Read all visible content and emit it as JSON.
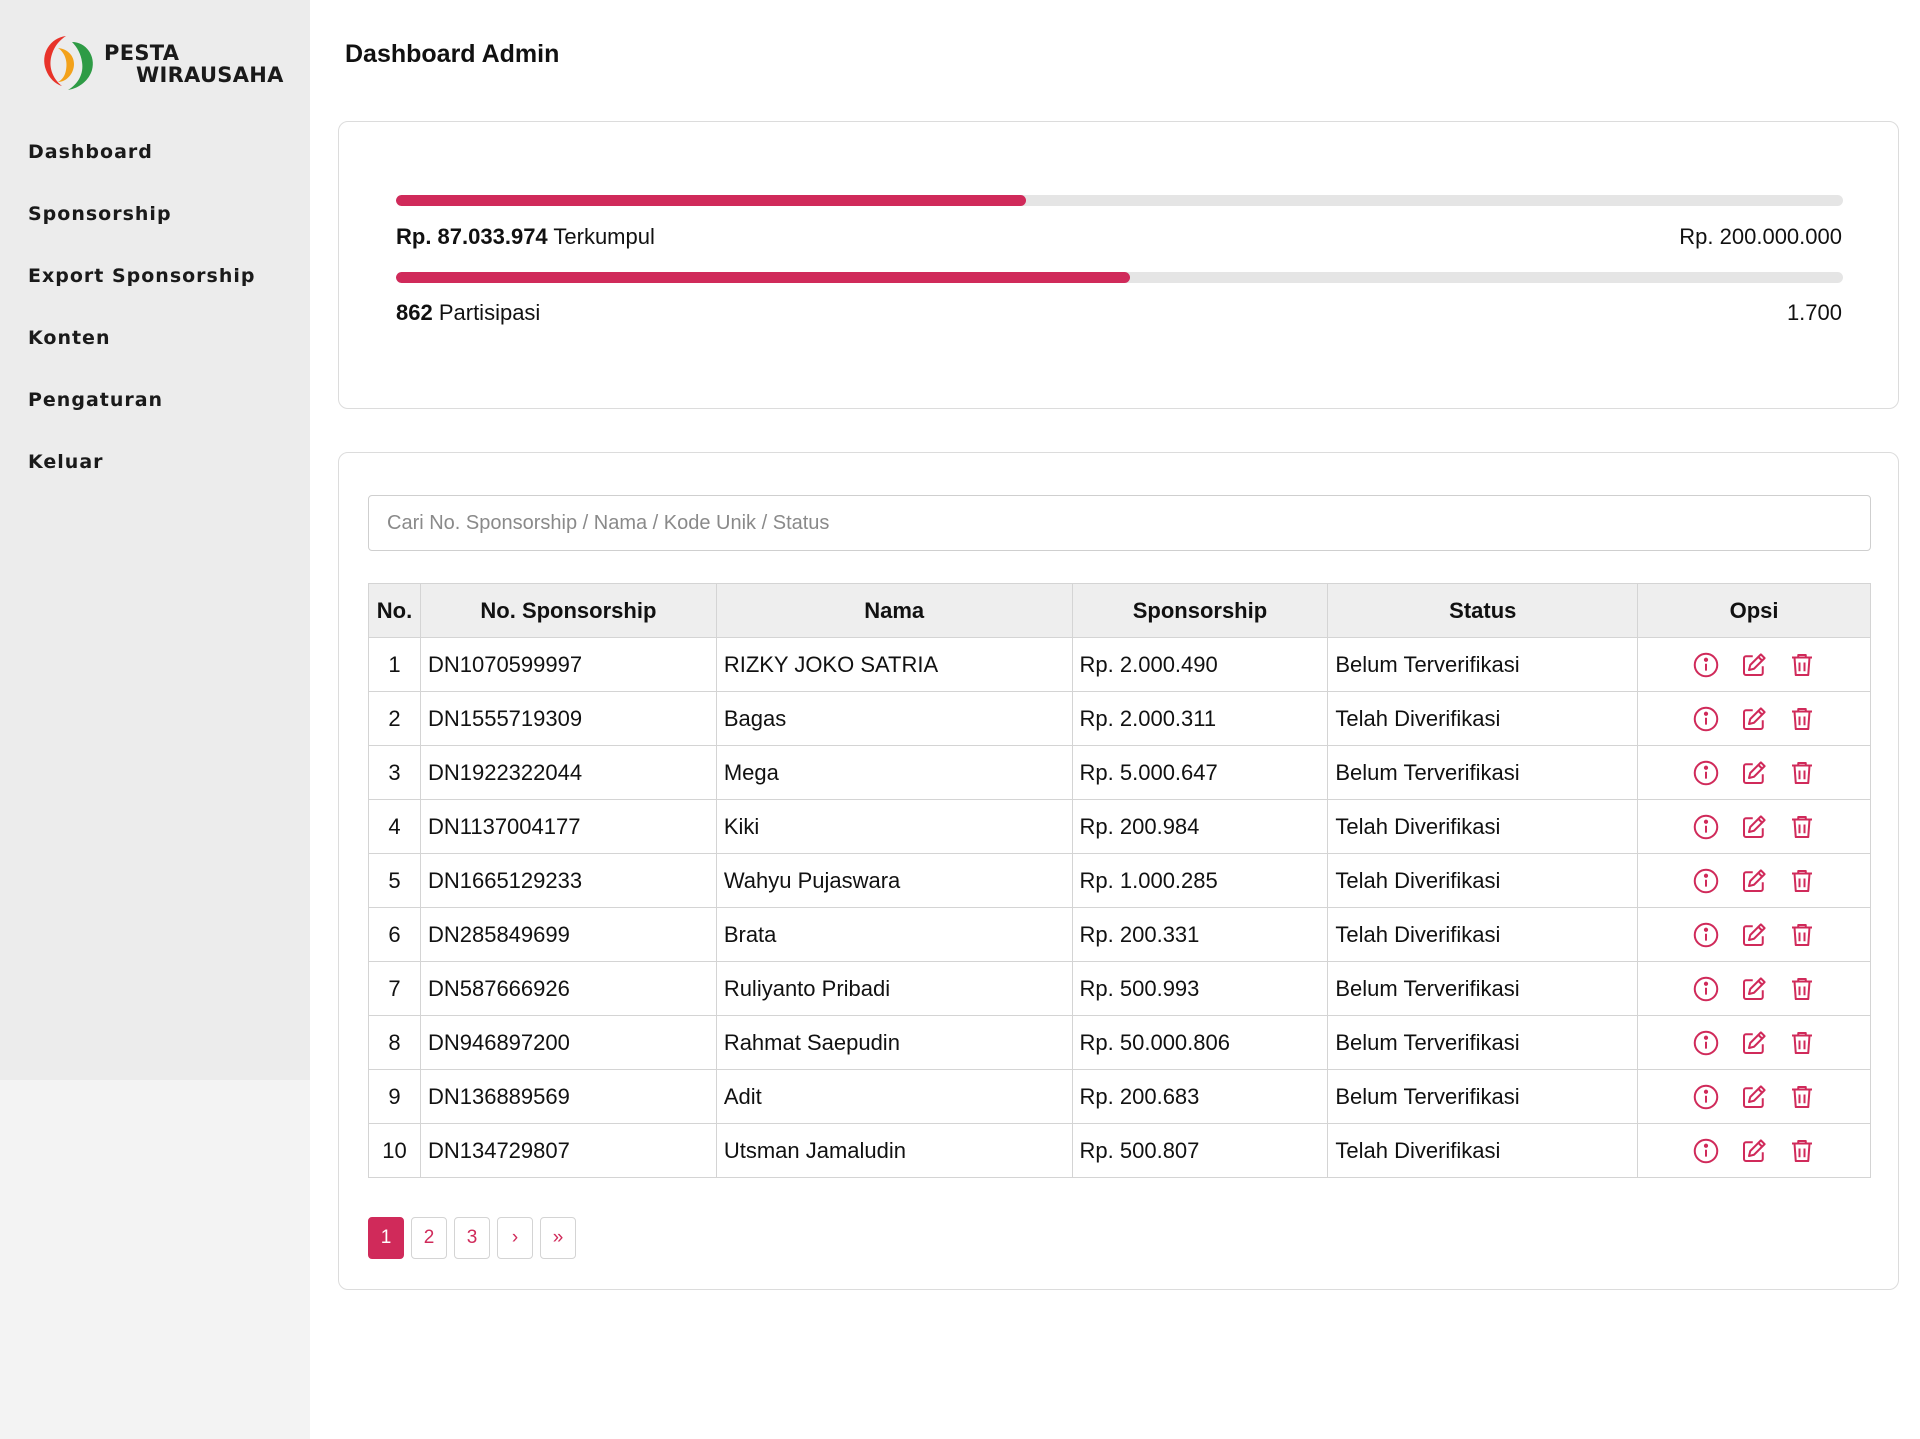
{
  "brand": {
    "name_line1": "PESTA",
    "name_line2": "WIRAUSAHA",
    "accent_color": "#d02a5a"
  },
  "sidebar": {
    "items": [
      {
        "label": "Dashboard"
      },
      {
        "label": "Sponsorship"
      },
      {
        "label": "Export Sponsorship"
      },
      {
        "label": "Konten"
      },
      {
        "label": "Pengaturan"
      },
      {
        "label": "Keluar"
      }
    ]
  },
  "header": {
    "title": "Dashboard Admin"
  },
  "progress": {
    "funds": {
      "collected": "Rp. 87.033.974",
      "collected_suffix": " Terkumpul",
      "target": "Rp. 200.000.000",
      "fraction": 0.4352
    },
    "participants": {
      "count": "862",
      "count_suffix": " Partisipasi",
      "target": "1.700",
      "fraction": 0.5071
    }
  },
  "search": {
    "placeholder": "Cari No. Sponsorship / Nama / Kode Unik / Status",
    "value": ""
  },
  "table": {
    "headers": [
      "No.",
      "No. Sponsorship",
      "Nama",
      "Sponsorship",
      "Status",
      "Opsi"
    ],
    "rows": [
      {
        "no": "1",
        "id": "DN1070599997",
        "name": "RIZKY JOKO SATRIA",
        "amount": "Rp. 2.000.490",
        "status": "Belum Terverifikasi"
      },
      {
        "no": "2",
        "id": "DN1555719309",
        "name": "Bagas",
        "amount": "Rp. 2.000.311",
        "status": "Telah Diverifikasi"
      },
      {
        "no": "3",
        "id": "DN1922322044",
        "name": "Mega",
        "amount": "Rp. 5.000.647",
        "status": "Belum Terverifikasi"
      },
      {
        "no": "4",
        "id": "DN1137004177",
        "name": "Kiki",
        "amount": "Rp. 200.984",
        "status": "Telah Diverifikasi"
      },
      {
        "no": "5",
        "id": "DN1665129233",
        "name": "Wahyu Pujaswara",
        "amount": "Rp. 1.000.285",
        "status": "Telah Diverifikasi"
      },
      {
        "no": "6",
        "id": "DN285849699",
        "name": "Brata",
        "amount": "Rp. 200.331",
        "status": "Telah Diverifikasi"
      },
      {
        "no": "7",
        "id": "DN587666926",
        "name": "Ruliyanto Pribadi",
        "amount": "Rp. 500.993",
        "status": "Belum Terverifikasi"
      },
      {
        "no": "8",
        "id": "DN946897200",
        "name": "Rahmat Saepudin",
        "amount": "Rp. 50.000.806",
        "status": "Belum Terverifikasi"
      },
      {
        "no": "9",
        "id": "DN136889569",
        "name": "Adit",
        "amount": "Rp. 200.683",
        "status": "Belum Terverifikasi"
      },
      {
        "no": "10",
        "id": "DN134729807",
        "name": "Utsman Jamaludin",
        "amount": "Rp. 500.807",
        "status": "Telah Diverifikasi"
      }
    ],
    "row_actions": [
      "info-icon",
      "edit-icon",
      "trash-icon"
    ]
  },
  "pagination": {
    "pages": [
      "1",
      "2",
      "3"
    ],
    "current": "1",
    "next_label": "›",
    "last_label": "»"
  }
}
